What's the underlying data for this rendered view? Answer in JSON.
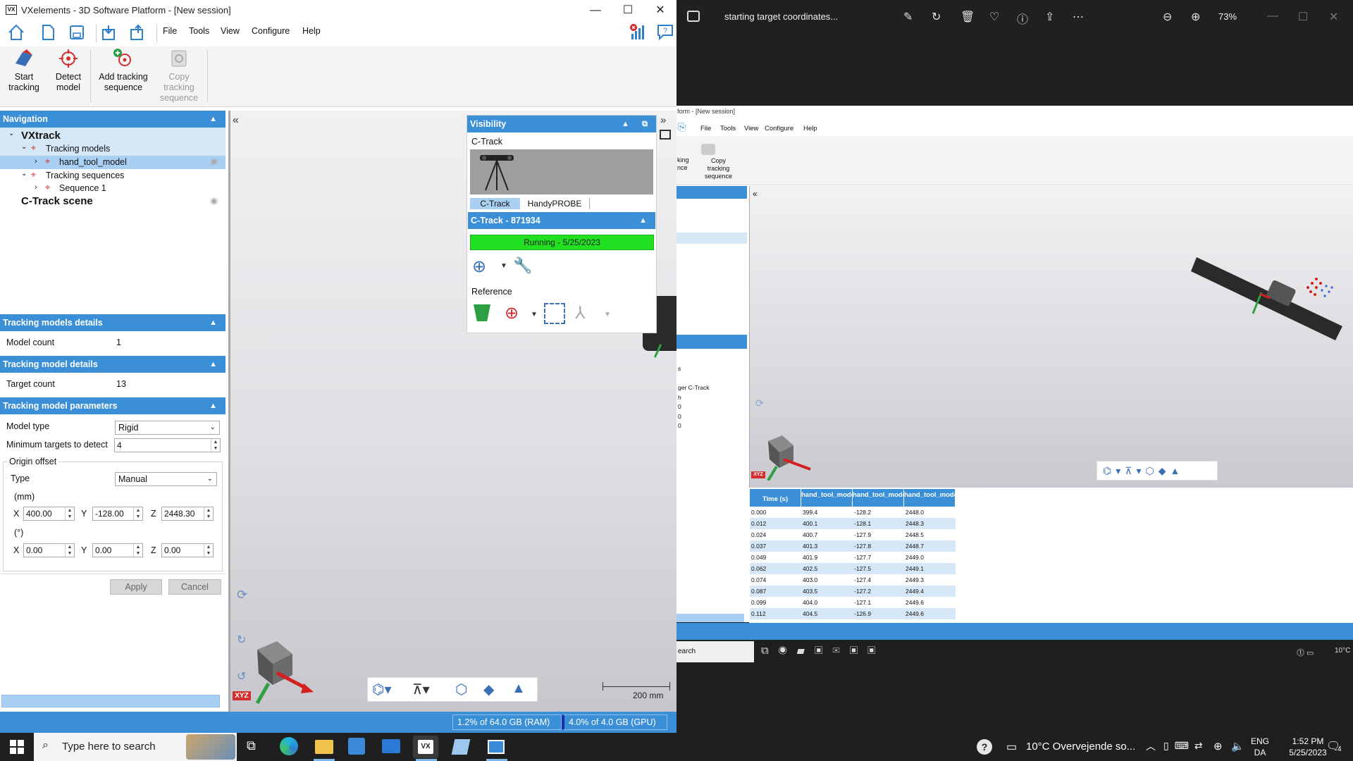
{
  "vx": {
    "title": "VXelements - 3D Software Platform - [New session]",
    "menu": [
      "File",
      "Tools",
      "View",
      "Configure",
      "Help"
    ],
    "ribbon": {
      "start_tracking": [
        "Start",
        "tracking"
      ],
      "detect_model": [
        "Detect",
        "model"
      ],
      "add_tracking_sequence": [
        "Add tracking",
        "sequence"
      ],
      "copy_tracking_sequence": [
        "Copy",
        "tracking",
        "sequence"
      ]
    },
    "nav": {
      "header": "Navigation",
      "root": "VXtrack",
      "tracking_models": "Tracking models",
      "hand_tool_model": "hand_tool_model",
      "tracking_sequences": "Tracking sequences",
      "sequence1": "Sequence 1",
      "ctrack_scene": "C-Track scene"
    },
    "models_details": {
      "header": "Tracking models details",
      "label": "Model count",
      "value": "1"
    },
    "model_details": {
      "header": "Tracking model details",
      "label": "Target count",
      "value": "13"
    },
    "params": {
      "header": "Tracking model parameters",
      "model_type_label": "Model type",
      "model_type_value": "Rigid",
      "min_targets_label": "Minimum targets to detect",
      "min_targets_value": "4",
      "origin_offset": "Origin offset",
      "type_label": "Type",
      "type_value": "Manual",
      "mm": "(mm)",
      "deg": "(°)",
      "x_label": "X",
      "y_label": "Y",
      "z_label": "Z",
      "x_mm": "400.00",
      "y_mm": "-128.00",
      "z_mm": "2448.30",
      "x_deg": "0.00",
      "y_deg": "0.00",
      "z_deg": "0.00",
      "apply": "Apply",
      "cancel": "Cancel"
    },
    "visibility": {
      "header": "Visibility",
      "ctrack_label": "C-Track",
      "tab_ctrack": "C-Track",
      "tab_handyprobe": "HandyPROBE",
      "device_header": "C-Track - 871934",
      "status": "Running - 5/25/2023",
      "reference": "Reference"
    },
    "scale": "200 mm",
    "axis_label": "XYZ",
    "status": {
      "ram": "1.2% of 64.0 GB (RAM)",
      "gpu": "4.0% of 4.0 GB (GPU)"
    }
  },
  "viewer": {
    "title": "starting target coordinates...",
    "zoom": "73%",
    "inner_title": "form - [New session]",
    "inner_menu": [
      "File",
      "Tools",
      "View",
      "Configure",
      "Help"
    ],
    "inner_partial": "king\nnce",
    "inner_copy": [
      "Copy",
      "tracking",
      "sequence"
    ],
    "inner_side_text": [
      "s",
      "ger C-Track",
      "h",
      "0",
      "0",
      "0"
    ],
    "inner_search": "earch",
    "inner_temp": "10°C",
    "table": {
      "headers": [
        "Time (s)",
        "hand_tool_model",
        "hand_tool_model",
        "hand_tool_model"
      ],
      "rows": [
        [
          "0.000",
          "399.4",
          "-128.2",
          "2448.0"
        ],
        [
          "0.012",
          "400.1",
          "-128.1",
          "2448.3"
        ],
        [
          "0.024",
          "400.7",
          "-127.9",
          "2448.5"
        ],
        [
          "0.037",
          "401.3",
          "-127.8",
          "2448.7"
        ],
        [
          "0.049",
          "401.9",
          "-127.7",
          "2449.0"
        ],
        [
          "0.062",
          "402.5",
          "-127.5",
          "2449.1"
        ],
        [
          "0.074",
          "403.0",
          "-127.4",
          "2449.3"
        ],
        [
          "0.087",
          "403.5",
          "-127.2",
          "2449.4"
        ],
        [
          "0.099",
          "404.0",
          "-127.1",
          "2449.6"
        ],
        [
          "0.112",
          "404.5",
          "-126.9",
          "2449.6"
        ]
      ]
    }
  },
  "taskbar": {
    "search_placeholder": "Type here to search",
    "weather": "10°C  Overvejende so...",
    "lang": [
      "ENG",
      "DA"
    ],
    "time": "1:52 PM",
    "date": "5/25/2023",
    "notif_count": "4"
  }
}
